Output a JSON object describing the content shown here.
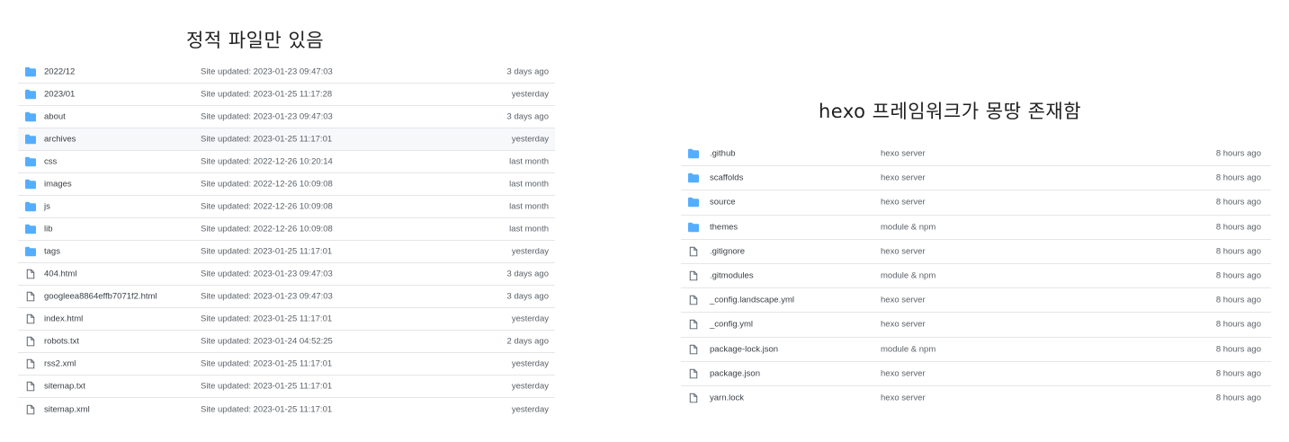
{
  "left_caption": "정적 파일만 있음",
  "right_caption": "hexo 프레임워크가 몽땅 존재함",
  "colors": {
    "folder": "#54aeff",
    "file_outline": "#57606a",
    "row_border": "#e4e6e9",
    "row_highlight": "#f6f8fa"
  },
  "left_table": {
    "rows": [
      {
        "type": "folder",
        "name": "2022/12",
        "message": "Site updated: 2023-01-23 09:47:03",
        "age": "3 days ago"
      },
      {
        "type": "folder",
        "name": "2023/01",
        "message": "Site updated: 2023-01-25 11:17:28",
        "age": "yesterday"
      },
      {
        "type": "folder",
        "name": "about",
        "message": "Site updated: 2023-01-23 09:47:03",
        "age": "3 days ago"
      },
      {
        "type": "folder",
        "name": "archives",
        "message": "Site updated: 2023-01-25 11:17:01",
        "age": "yesterday",
        "highlighted": true
      },
      {
        "type": "folder",
        "name": "css",
        "message": "Site updated: 2022-12-26 10:20:14",
        "age": "last month"
      },
      {
        "type": "folder",
        "name": "images",
        "message": "Site updated: 2022-12-26 10:09:08",
        "age": "last month"
      },
      {
        "type": "folder",
        "name": "js",
        "message": "Site updated: 2022-12-26 10:09:08",
        "age": "last month"
      },
      {
        "type": "folder",
        "name": "lib",
        "message": "Site updated: 2022-12-26 10:09:08",
        "age": "last month"
      },
      {
        "type": "folder",
        "name": "tags",
        "message": "Site updated: 2023-01-25 11:17:01",
        "age": "yesterday"
      },
      {
        "type": "file",
        "name": "404.html",
        "message": "Site updated: 2023-01-23 09:47:03",
        "age": "3 days ago"
      },
      {
        "type": "file",
        "name": "googleea8864effb7071f2.html",
        "message": "Site updated: 2023-01-23 09:47:03",
        "age": "3 days ago"
      },
      {
        "type": "file",
        "name": "index.html",
        "message": "Site updated: 2023-01-25 11:17:01",
        "age": "yesterday"
      },
      {
        "type": "file",
        "name": "robots.txt",
        "message": "Site updated: 2023-01-24 04:52:25",
        "age": "2 days ago"
      },
      {
        "type": "file",
        "name": "rss2.xml",
        "message": "Site updated: 2023-01-25 11:17:01",
        "age": "yesterday"
      },
      {
        "type": "file",
        "name": "sitemap.txt",
        "message": "Site updated: 2023-01-25 11:17:01",
        "age": "yesterday"
      },
      {
        "type": "file",
        "name": "sitemap.xml",
        "message": "Site updated: 2023-01-25 11:17:01",
        "age": "yesterday"
      }
    ]
  },
  "right_table": {
    "rows": [
      {
        "type": "folder",
        "name": ".github",
        "message": "hexo server",
        "age": "8 hours ago"
      },
      {
        "type": "folder",
        "name": "scaffolds",
        "message": "hexo server",
        "age": "8 hours ago"
      },
      {
        "type": "folder",
        "name": "source",
        "message": "hexo server",
        "age": "8 hours ago"
      },
      {
        "type": "folder",
        "name": "themes",
        "message": "module & npm",
        "age": "8 hours ago"
      },
      {
        "type": "file",
        "name": ".gitignore",
        "message": "hexo server",
        "age": "8 hours ago"
      },
      {
        "type": "file",
        "name": ".gitmodules",
        "message": "module & npm",
        "age": "8 hours ago"
      },
      {
        "type": "file",
        "name": "_config.landscape.yml",
        "message": "hexo server",
        "age": "8 hours ago"
      },
      {
        "type": "file",
        "name": "_config.yml",
        "message": "hexo server",
        "age": "8 hours ago"
      },
      {
        "type": "file",
        "name": "package-lock.json",
        "message": "module & npm",
        "age": "8 hours ago"
      },
      {
        "type": "file",
        "name": "package.json",
        "message": "hexo server",
        "age": "8 hours ago"
      },
      {
        "type": "file",
        "name": "yarn.lock",
        "message": "hexo server",
        "age": "8 hours ago"
      }
    ]
  }
}
